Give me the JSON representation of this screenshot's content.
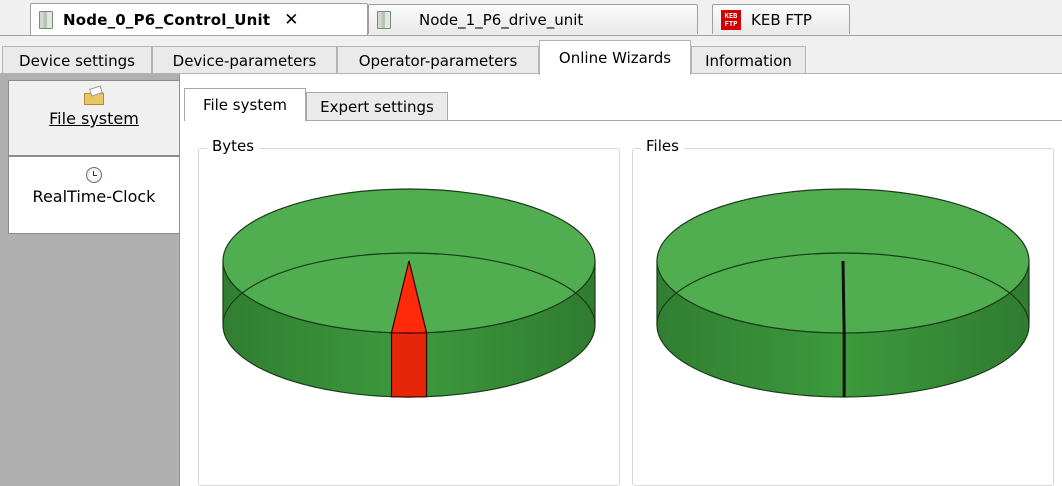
{
  "doc_tabs": [
    {
      "title": "Node_0_P6_Control_Unit",
      "close": "✕",
      "active": true,
      "icon": "device-icon"
    },
    {
      "title": "Node_1_P6_drive_unit",
      "active": false,
      "icon": "device-icon"
    },
    {
      "title": "KEB FTP",
      "active": false,
      "icon": "keb-ftp-icon",
      "icon_text": [
        "KEB",
        "FTP"
      ]
    }
  ],
  "settings_tabs": [
    {
      "label": "Device settings"
    },
    {
      "label": "Device-parameters"
    },
    {
      "label": "Operator-parameters"
    },
    {
      "label": "Online Wizards",
      "active": true
    },
    {
      "label": "Information"
    }
  ],
  "left_nav": [
    {
      "label": "File system",
      "active": true,
      "icon": "folder-edit-icon"
    },
    {
      "label": "RealTime-Clock",
      "active": false,
      "icon": "clock-icon"
    }
  ],
  "sub_tabs": [
    {
      "label": "File system",
      "active": true
    },
    {
      "label": "Expert settings",
      "active": false
    }
  ],
  "charts": {
    "bytes": {
      "legend": "Bytes"
    },
    "files": {
      "legend": "Files"
    }
  },
  "chart_data": [
    {
      "type": "pie",
      "style": "3d",
      "series": [
        {
          "values": [
            0.97,
            0.03
          ],
          "colors": [
            "#3c9a3c",
            "#ff2a0a"
          ]
        }
      ]
    },
    {
      "type": "pie",
      "style": "3d",
      "series": [
        {
          "values": [
            0.998,
            0.002
          ],
          "colors": [
            "#3c9a3c",
            "#111111"
          ]
        }
      ]
    }
  ],
  "colors": {
    "pie_green": "#3c9a3c",
    "pie_red": "#ff2a0a"
  }
}
